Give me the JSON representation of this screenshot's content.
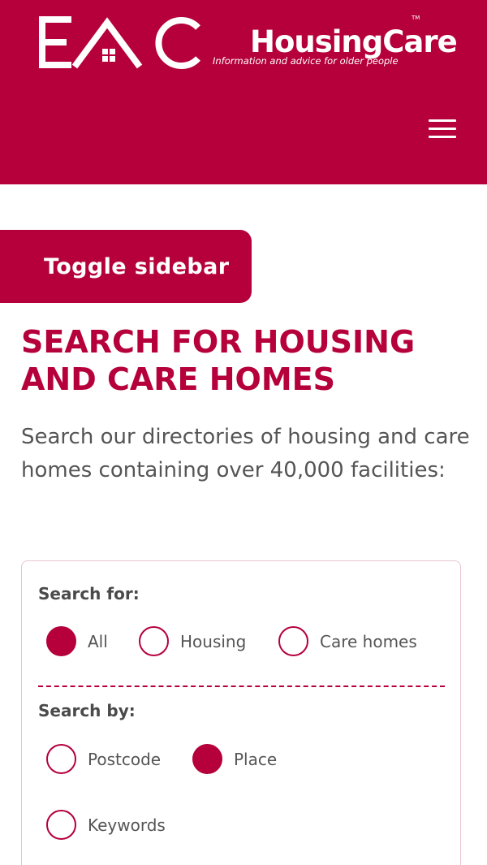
{
  "header": {
    "logo_name": "HousingCare",
    "logo_tm": "TM",
    "logo_tagline": "Information and advice for older people",
    "logo_mark": "EAC",
    "menu_icon": "hamburger-menu-icon"
  },
  "sidebar_toggle": {
    "label": "Toggle sidebar"
  },
  "main": {
    "title": "SEARCH FOR HOUSING AND CARE HOMES",
    "intro": "Search our directories of housing and care homes containing over 40,000 facilities:"
  },
  "search": {
    "search_for_label": "Search for:",
    "search_for_options": [
      {
        "label": "All",
        "checked": true
      },
      {
        "label": "Housing",
        "checked": false
      },
      {
        "label": "Care homes",
        "checked": false
      }
    ],
    "search_by_label": "Search by:",
    "search_by_options": [
      {
        "label": "Postcode",
        "checked": false
      },
      {
        "label": "Place",
        "checked": true
      },
      {
        "label": "Keywords",
        "checked": false
      }
    ]
  },
  "colors": {
    "brand": "#b5003b",
    "text": "#555555",
    "panel_border": "#e6c4cf"
  }
}
